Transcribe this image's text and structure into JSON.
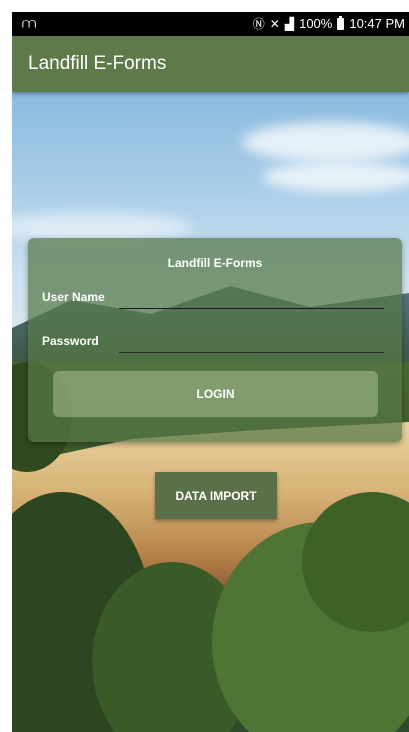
{
  "status_bar": {
    "left_icon": "notification-icon",
    "battery_percent": "100%",
    "time": "10:47 PM",
    "icons": [
      "nfc-icon",
      "mute-icon",
      "signal-icon",
      "battery-icon"
    ]
  },
  "app_bar": {
    "title": "Landfill E-Forms"
  },
  "login_form": {
    "title": "Landfill E-Forms",
    "username_label": "User Name",
    "username_value": "",
    "password_label": "Password",
    "password_value": "",
    "login_label": "LOGIN"
  },
  "actions": {
    "data_import_label": "DATA IMPORT"
  },
  "colors": {
    "app_bar": "#5f7a4a",
    "card": "#56784a",
    "import_button": "#5a7048"
  }
}
